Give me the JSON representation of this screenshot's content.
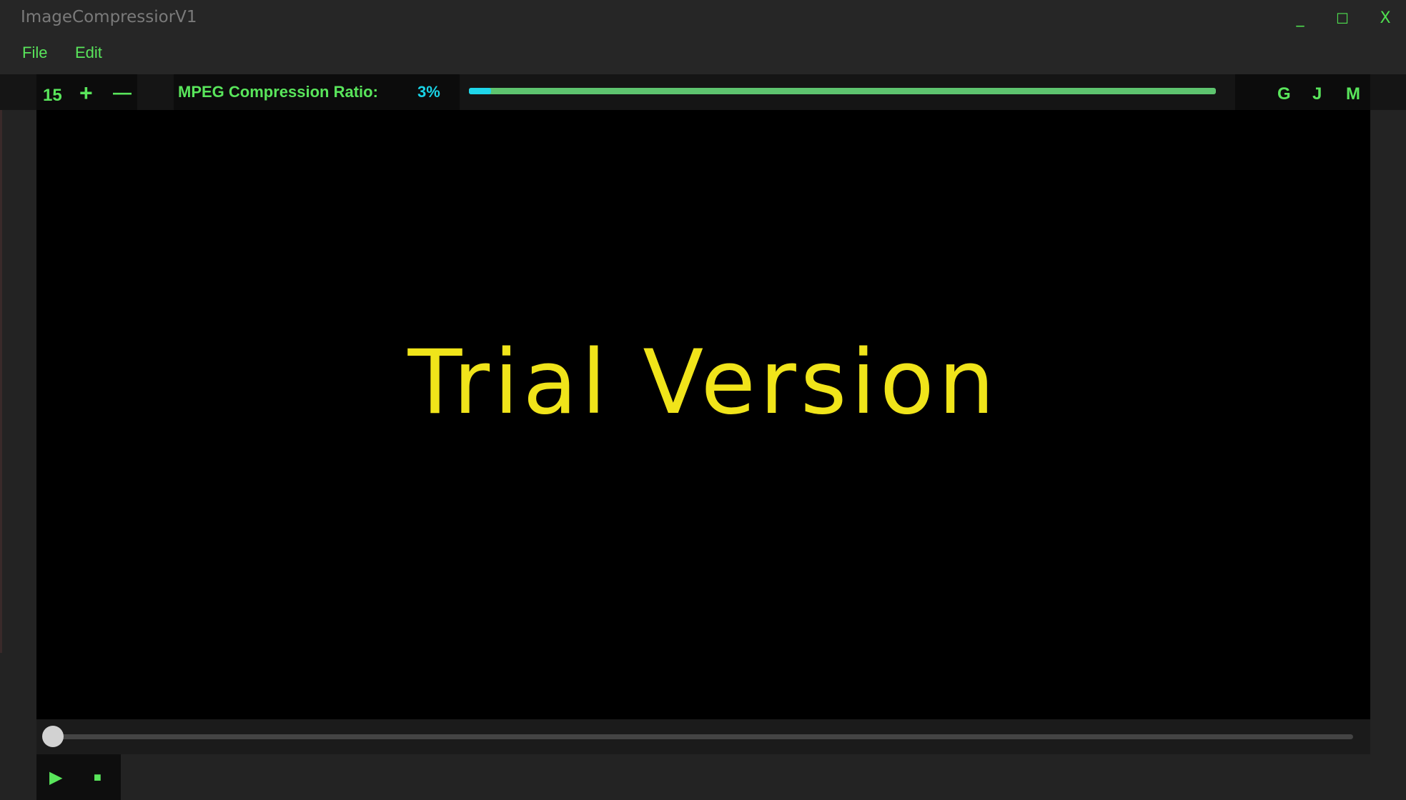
{
  "window": {
    "title": "ImageCompressiorV1",
    "minimize": "_",
    "maximize": "☐",
    "close": "X"
  },
  "menu": {
    "file": "File",
    "edit": "Edit"
  },
  "toolbar": {
    "fps_value": "15",
    "increase": "+",
    "decrease": "—",
    "ratio_label": "MPEG Compression Ratio:",
    "ratio_value": "3%",
    "ratio_percent": 3,
    "modes": [
      "G",
      "J",
      "M"
    ]
  },
  "video": {
    "overlay_text": "Trial Version"
  },
  "playback": {
    "play": "▶",
    "stop": "■",
    "position_fraction": 0
  },
  "colors": {
    "accent_green": "#59e55b",
    "ratio_cyan": "#1fd6ea",
    "overlay_yellow": "#f0e41a"
  }
}
